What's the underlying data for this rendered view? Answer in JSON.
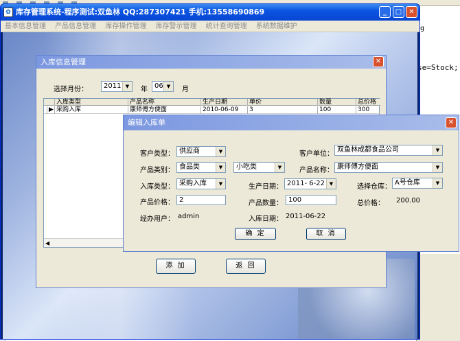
{
  "ide": {
    "header": "ug",
    "code": "se=Stock;"
  },
  "main": {
    "title": "库存管理系统-程序测试:双鱼林 QQ:287307421 手机:13558690869",
    "menu": [
      "基本信息管理",
      "产品信息管理",
      "库存操作管理",
      "库存警示管理",
      "统计查询管理",
      "系统数据维护"
    ]
  },
  "sub": {
    "title": "入库信息管理",
    "month_label": "选择月份：",
    "year_value": "2011",
    "year_label": "年",
    "month_value": "06",
    "month_suffix": "月",
    "columns": [
      "入库类型",
      "产品名称",
      "生产日期",
      "单价",
      "数量",
      "总价格"
    ],
    "rows": [
      [
        "采购入库",
        "康师傅方便面",
        "2010-06-09",
        "3",
        "100",
        "300"
      ]
    ],
    "add_button": "添 加",
    "back_button": "返 回"
  },
  "dialog": {
    "title": "编辑入库单",
    "customer_type_label": "客户类型：",
    "customer_type": "供应商",
    "customer_unit_label": "客户单位：",
    "customer_unit": "双鱼林成都食品公司",
    "product_category_label": "产品类别：",
    "product_category": "食品类",
    "product_subcategory": "小吃类",
    "product_name_label": "产品名称：",
    "product_name": "康师傅方便面",
    "stockin_type_label": "入库类型：",
    "stockin_type": "采购入库",
    "production_date_label": "生产日期：",
    "production_date": "2011- 6-22",
    "warehouse_label": "选择仓库：",
    "warehouse": "A号仓库",
    "price_label": "产品价格：",
    "price": "2",
    "quantity_label": "产品数量：",
    "quantity": "100",
    "total_label": "总价格：",
    "total": "200.00",
    "operator_label": "经办用户：",
    "operator": "admin",
    "stockin_date_label": "入库日期：",
    "stockin_date": "2011-06-22",
    "ok_button": "确 定",
    "cancel_button": "取 消"
  }
}
